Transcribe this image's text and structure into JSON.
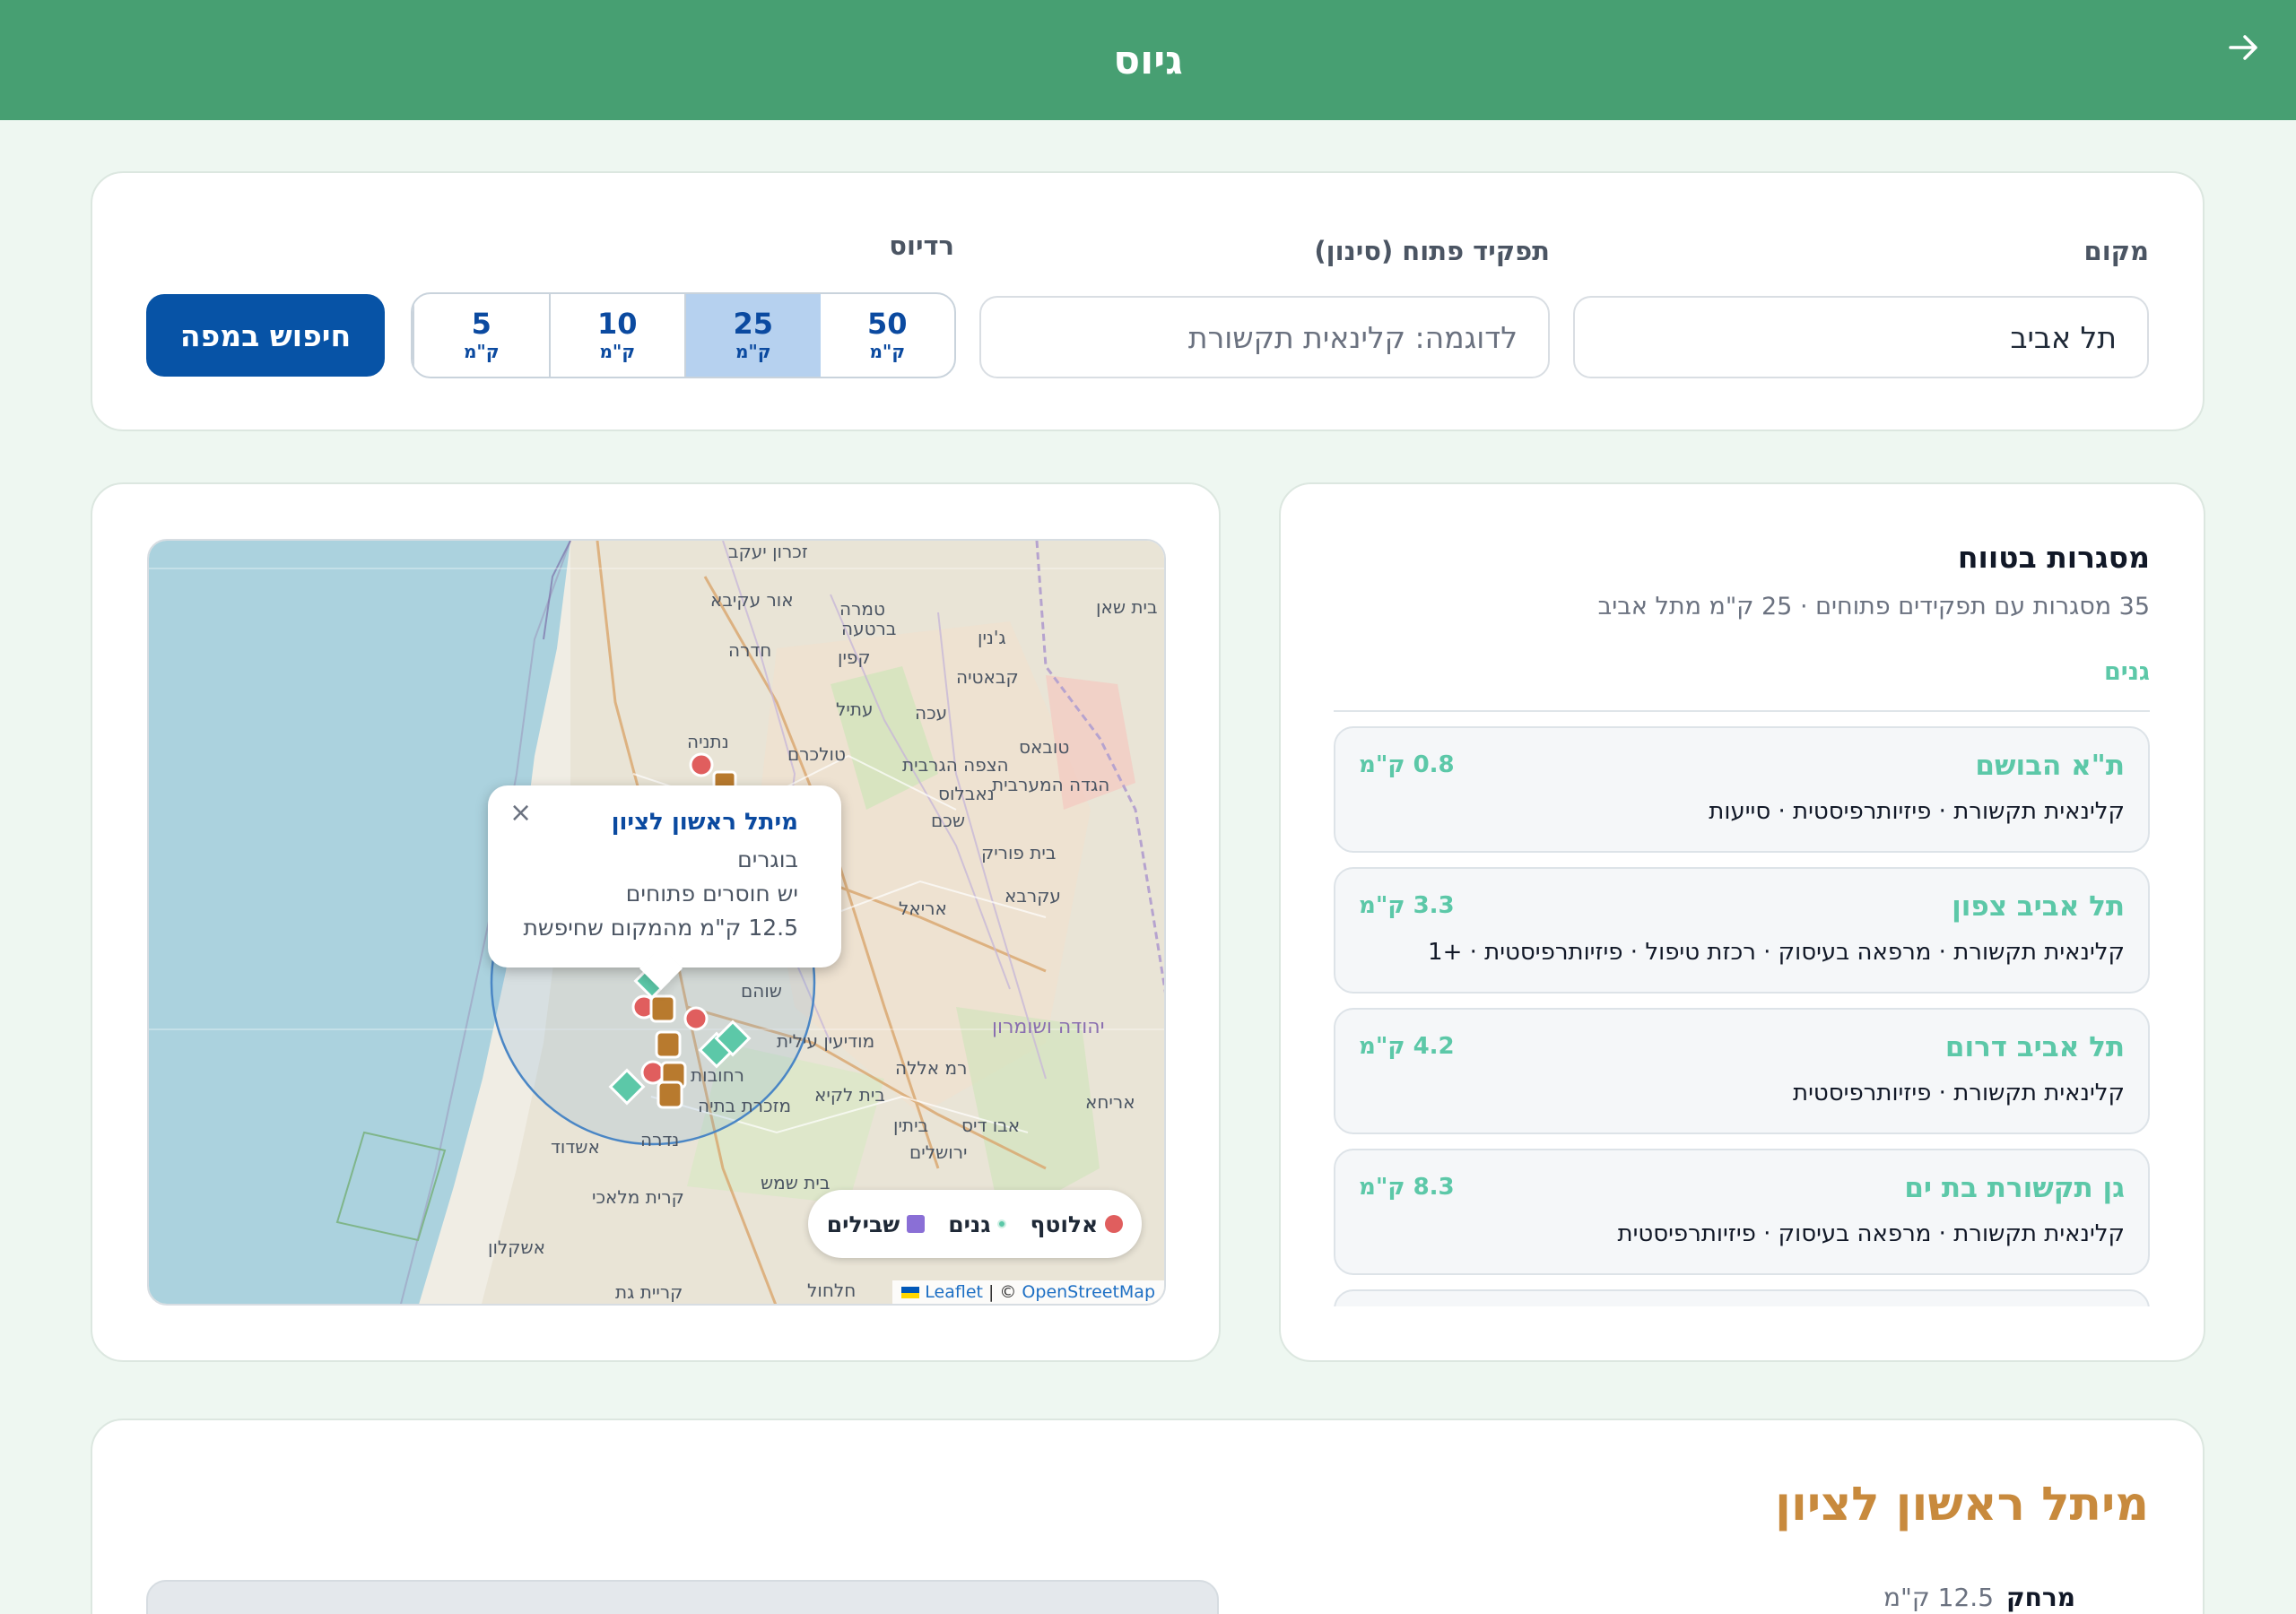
{
  "header": {
    "title": "גיוס",
    "back_icon": "arrow-right-icon",
    "color": "#479f72"
  },
  "search": {
    "location_label": "מקום",
    "location_value": "תל אביב",
    "role_label": "תפקיד פתוח (סינון)",
    "role_placeholder": "לדוגמה: קלינאית תקשורת",
    "radius_label": "רדיוס",
    "radius_options": [
      {
        "value": "5",
        "unit": "ק\"מ"
      },
      {
        "value": "10",
        "unit": "ק\"מ"
      },
      {
        "value": "25",
        "unit": "ק\"מ"
      },
      {
        "value": "50",
        "unit": "ק\"מ"
      }
    ],
    "radius_selected": "25",
    "button_label": "חיפוש במפה"
  },
  "map": {
    "place_labels": [
      "זכרון יעקב",
      "אור עקיבא",
      "חדרה",
      "נתניה",
      "טולכרם",
      "ברטעה",
      "קפין",
      "עתיל",
      "ג'נין",
      "קבאטיה",
      "בית שאן",
      "עכה",
      "שכם",
      "נאבלוס",
      "הגדה המערבית",
      "הצפה הגרבית",
      "טובאס",
      "בית פוריק",
      "עקרבא",
      "אריאל",
      "שוהם",
      "מודיעין עילית",
      "רמ אללה",
      "בית לקיא",
      "ירושלים",
      "בית שמש",
      "רחובות",
      "מזכרת בתיה",
      "נדרה",
      "אשדוד",
      "קרית מלאכי",
      "אשקלון",
      "קריית גת",
      "חלחול",
      "יהודה ושומרון",
      "אריחא",
      "אבו דיס",
      "ביתין",
      "טמרה"
    ],
    "popup": {
      "title": "מיתל ראשון לציון",
      "line1": "בוגרים",
      "line2": "יש חוסרים פתוחים",
      "line3": "12.5 ק\"מ מהמקום שחיפשת",
      "close": "×"
    },
    "legend": [
      {
        "label": "אלוטף",
        "color": "#e05e5e"
      },
      {
        "label": "גנים",
        "color": "#5cc8a8"
      },
      {
        "label": "שבילים",
        "color": "#8a6fd6"
      }
    ],
    "attribution": {
      "leaflet": "Leaflet",
      "sep": "| ©",
      "osm": "OpenStreetMap"
    }
  },
  "list": {
    "title": "מסגרות בטווח",
    "subtitle": "35 מסגרות עם תפקידים פתוחים · 25 ק\"מ מתל אביב",
    "group_label": "גנים",
    "items": [
      {
        "name": "ת\"א הבושם",
        "distance": "0.8 ק\"מ",
        "roles": "קלינאית תקשורת · פיזיותרפיסטית · סייעות"
      },
      {
        "name": "תל אביב צפון",
        "distance": "3.3 ק\"מ",
        "roles": "קלינאית תקשורת · מרפאה בעיסוק · רכזת טיפול · פיזיותרפיסטית · +1"
      },
      {
        "name": "תל אביב דרום",
        "distance": "4.2 ק\"מ",
        "roles": "קלינאית תקשורת · פיזיותרפיסטית"
      },
      {
        "name": "גן תקשורת בת ים",
        "distance": "8.3 ק\"מ",
        "roles": "קלינאית תקשורת · מרפאה בעיסוק · פיזיותרפיסטית"
      }
    ]
  },
  "detail": {
    "title": "מיתל ראשון לציון",
    "distance_label": "מרחק",
    "distance_value": "12.5 ק\"מ"
  }
}
